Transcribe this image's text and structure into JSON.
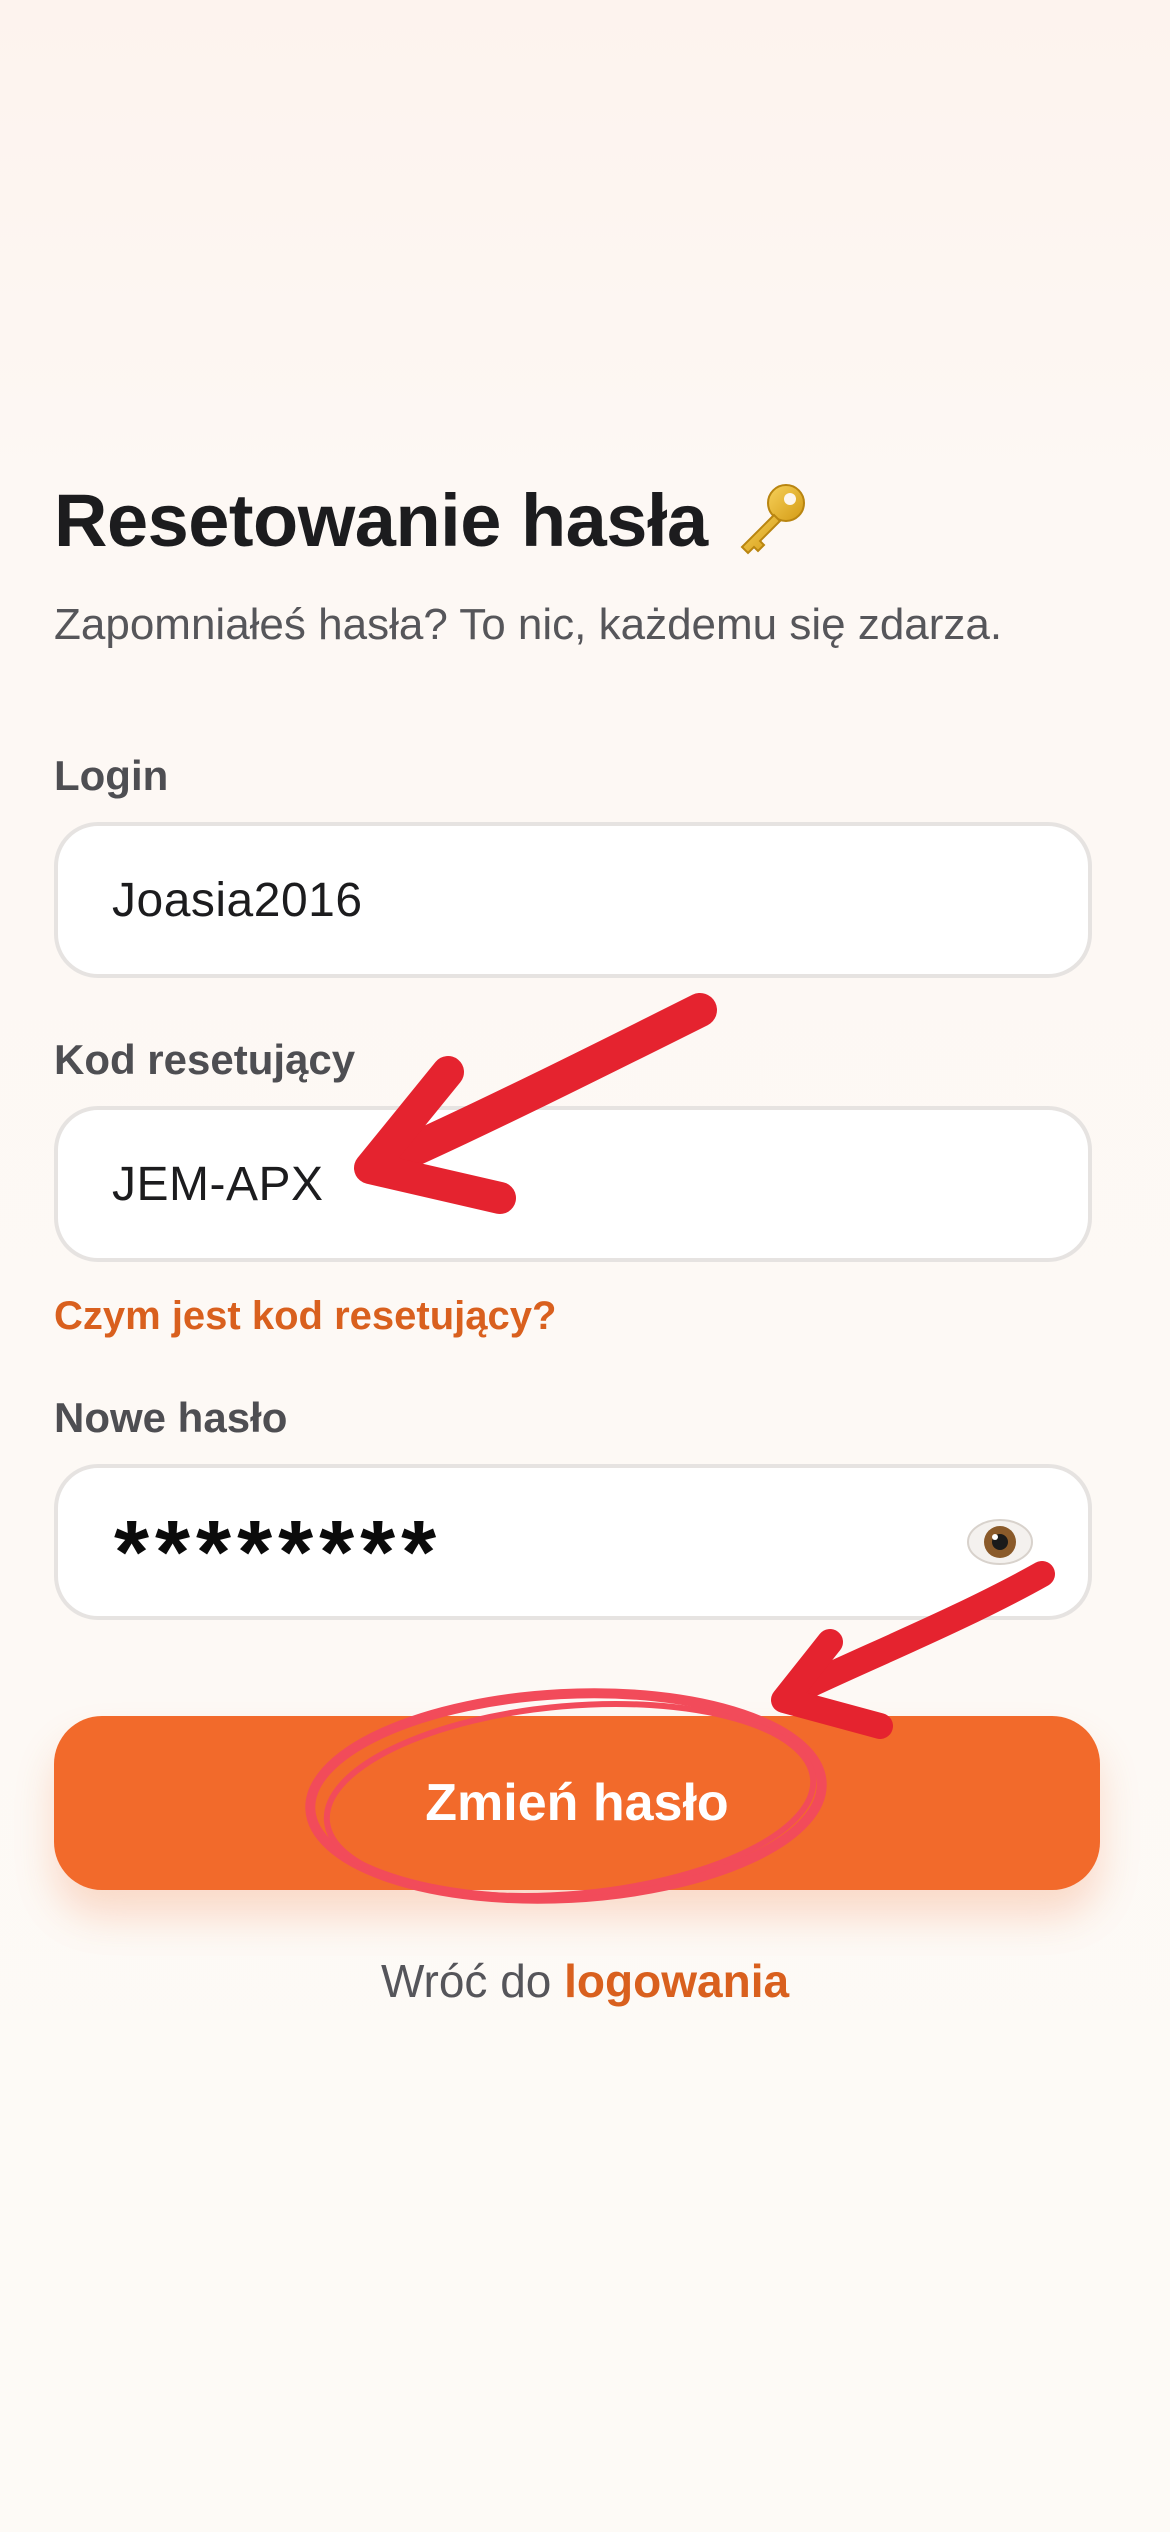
{
  "header": {
    "title": "Resetowanie hasła",
    "title_icon": "key-icon",
    "subtitle": "Zapomniałeś hasła? To nic, każdemu się zdarza."
  },
  "form": {
    "login_label": "Login",
    "login_value": "Joasia2016",
    "code_label": "Kod resetujący",
    "code_value": "JEM-APX",
    "code_help_link": "Czym jest kod resetujący?",
    "password_label": "Nowe hasło",
    "password_value": "********",
    "password_toggle_icon": "eye-icon",
    "submit_label": "Zmień hasło"
  },
  "footer": {
    "back_prefix": "Wróć do",
    "back_link": "logowania"
  },
  "colors": {
    "accent": "#f26a2b",
    "link": "#d9601e",
    "annotation_red": "#e5232f"
  }
}
